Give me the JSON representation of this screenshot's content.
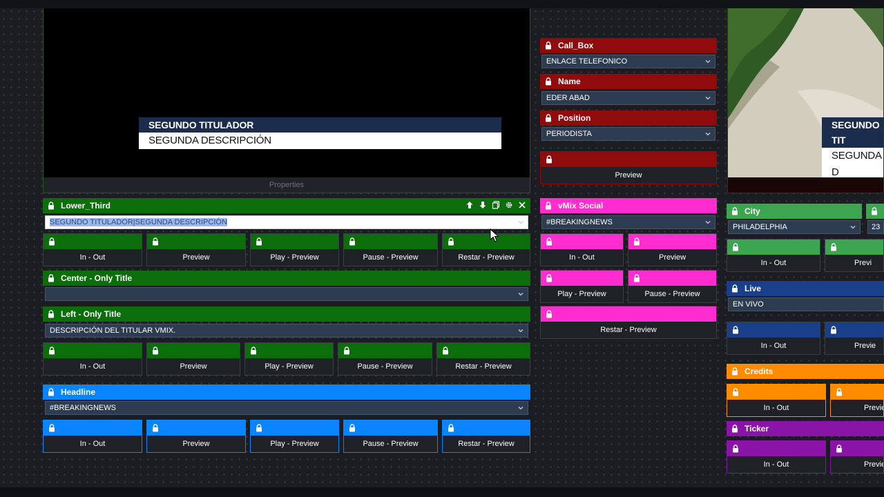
{
  "colors": {
    "green": "#0b6e0b",
    "red": "#900c0c",
    "blue": "#0a84ff",
    "magenta": "#ff2ccf",
    "lightgreen": "#3ba64f",
    "navy": "#1a3f8a",
    "orange": "#ff8c00",
    "purple": "#8a13a8"
  },
  "preview": {
    "title": "SEGUNDO TITULADOR",
    "description": "SEGUNDA DESCRIPCIÓN",
    "properties_label": "Properties"
  },
  "beach_preview": {
    "title": "SEGUNDO TIT",
    "description": "SEGUNDA D"
  },
  "lower_third": {
    "name": "Lower_Third",
    "value": "SEGUNDO TITULADOR|SEGUNDA DESCRIPCIÓN",
    "buttons": [
      "In - Out",
      "Preview",
      "Play - Preview",
      "Pause - Preview",
      "Restar - Preview"
    ]
  },
  "center_only_title": {
    "name": "Center - Only Title",
    "value": ""
  },
  "left_only_title": {
    "name": "Left - Only Title",
    "value": "DESCRIPCIÓN DEL TITULAR VMIX.",
    "buttons": [
      "In - Out",
      "Preview",
      "Play - Preview",
      "Pause - Preview",
      "Restar - Preview"
    ]
  },
  "headline": {
    "name": "Headline",
    "value": "#BREAKINGNEWS",
    "buttons": [
      "In - Out",
      "Preview",
      "Play - Preview",
      "Pause - Preview",
      "Restar - Preview"
    ]
  },
  "call_box": {
    "fields": [
      {
        "name": "Call_Box",
        "value": "ENLACE TELEFONICO"
      },
      {
        "name": "Name",
        "value": "EDER ABAD"
      },
      {
        "name": "Position",
        "value": "PERIODISTA"
      }
    ],
    "preview_button": "Preview"
  },
  "vmix_social": {
    "name": "vMix Social",
    "value": "#BREAKINGNEWS",
    "buttons": [
      "In - Out",
      "Preview",
      "Play - Preview",
      "Pause - Preview",
      "Restar - Preview"
    ]
  },
  "city": {
    "name": "City",
    "value": "PHILADELPHIA",
    "side_value": "23",
    "buttons": [
      "In - Out",
      "Previ"
    ]
  },
  "live": {
    "name": "Live",
    "value": "EN VIVO",
    "buttons": [
      "In - Out",
      "Previe"
    ]
  },
  "credits": {
    "name": "Credits",
    "buttons": [
      "In - Out",
      "Previe"
    ]
  },
  "ticker": {
    "name": "Ticker",
    "buttons": [
      "In - Out",
      "Previe"
    ]
  }
}
